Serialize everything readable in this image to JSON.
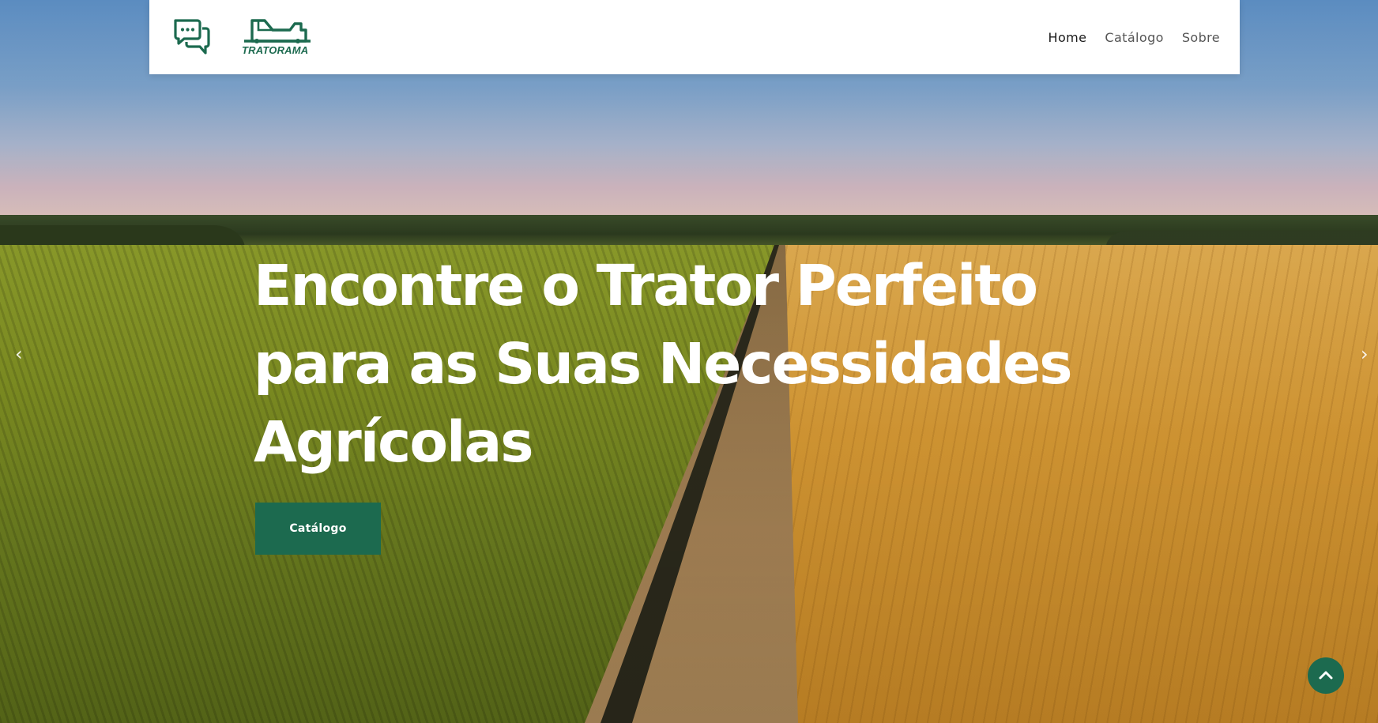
{
  "header": {
    "logo_text": "TRATORAMA",
    "nav": {
      "home": "Home",
      "catalog": "Catálogo",
      "about": "Sobre"
    }
  },
  "hero": {
    "title_line1": "Encontre o Trator Perfeito",
    "title_line2": "para as Suas Necessidades",
    "title_line3": "Agrícolas",
    "button_label": "Catálogo",
    "prev_arrow": "‹",
    "next_arrow": "›"
  },
  "icons": {
    "chat": "chat-bubbles-icon",
    "logo": "tractor-logo-icon",
    "back_to_top": "chevron-up-icon"
  },
  "colors": {
    "brand_green": "#1c6a4f",
    "header_bg": "#ffffff",
    "title_text": "#ffffff"
  }
}
